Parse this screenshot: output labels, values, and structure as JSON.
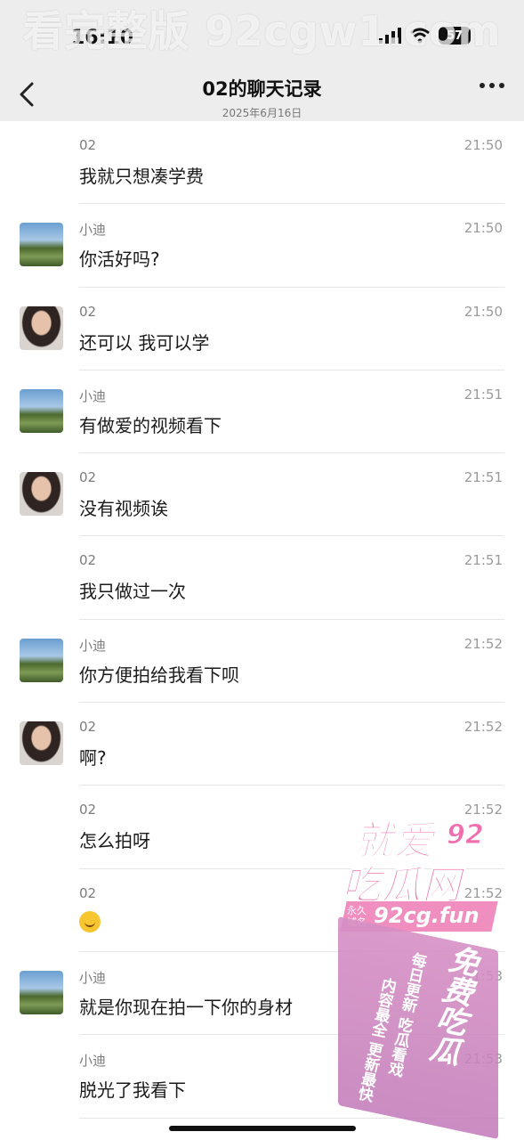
{
  "status": {
    "time": "16:10",
    "battery": "57"
  },
  "watermark": "看完整版 92cgw1.com",
  "header": {
    "title": "02的聊天记录",
    "date": "2025年6月16日"
  },
  "messages": [
    {
      "sender": "02",
      "time": "21:50",
      "text": "我就只想凑学费",
      "avatar": "none"
    },
    {
      "sender": "小迪",
      "time": "21:50",
      "text": "你活好吗?",
      "avatar": "a"
    },
    {
      "sender": "02",
      "time": "21:50",
      "text": "还可以 我可以学",
      "avatar": "b"
    },
    {
      "sender": "小迪",
      "time": "21:51",
      "text": "有做爱的视频看下",
      "avatar": "a"
    },
    {
      "sender": "02",
      "time": "21:51",
      "text": "没有视频诶",
      "avatar": "b"
    },
    {
      "sender": "02",
      "time": "21:51",
      "text": "我只做过一次",
      "avatar": "none"
    },
    {
      "sender": "小迪",
      "time": "21:52",
      "text": "你方便拍给我看下呗",
      "avatar": "a"
    },
    {
      "sender": "02",
      "time": "21:52",
      "text": "啊?",
      "avatar": "b"
    },
    {
      "sender": "02",
      "time": "21:52",
      "text": "怎么拍呀",
      "avatar": "none"
    },
    {
      "sender": "02",
      "time": "21:52",
      "text": "",
      "avatar": "none",
      "emoji": "laughing-crying-emoji"
    },
    {
      "sender": "小迪",
      "time": "21:53",
      "text": "就是你现在拍一下你的身材",
      "avatar": "a"
    },
    {
      "sender": "小迪",
      "time": "21:53",
      "text": "脱光了我看下",
      "avatar": "none"
    }
  ],
  "ad": {
    "title1": "就爱",
    "num": "92",
    "title2": "吃瓜网",
    "domain_label": "永久域名",
    "domain": "92cg.fun",
    "free": "免费吃瓜",
    "line1": "每日更新 吃瓜看戏",
    "line2": "内容最全 更新最快"
  }
}
